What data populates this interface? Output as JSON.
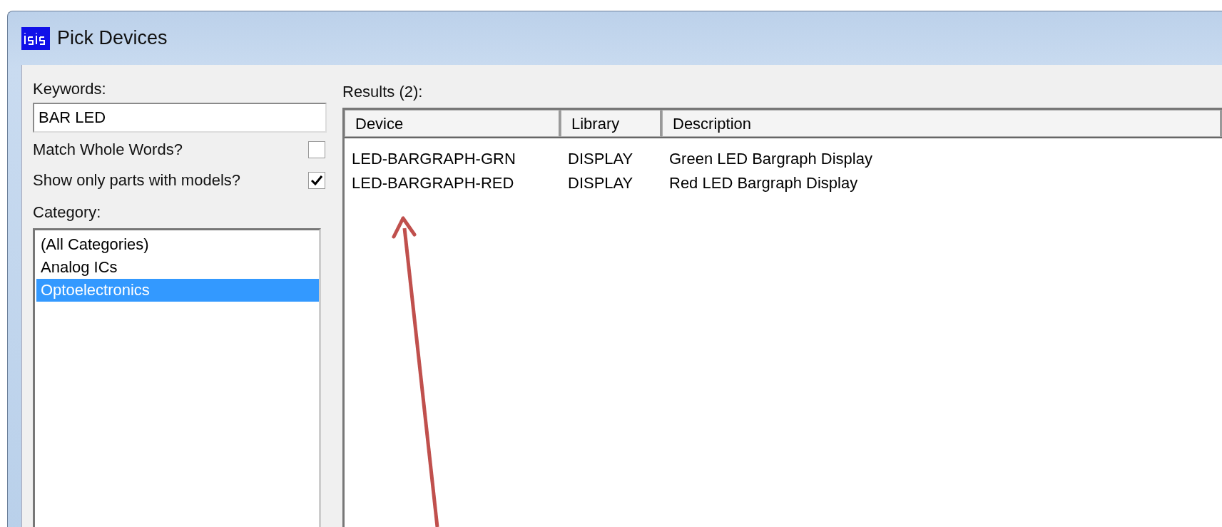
{
  "window": {
    "title": "Pick Devices"
  },
  "keywords": {
    "label": "Keywords:",
    "value": "BAR LED"
  },
  "options": [
    {
      "label": "Match Whole Words?",
      "checked": false
    },
    {
      "label": "Show only parts with models?",
      "checked": true
    }
  ],
  "category": {
    "label": "Category:",
    "items": [
      {
        "label": "(All Categories)",
        "selected": false
      },
      {
        "label": "Analog ICs",
        "selected": false
      },
      {
        "label": "Optoelectronics",
        "selected": true
      }
    ]
  },
  "results": {
    "label": "Results (2):",
    "columns": [
      "Device",
      "Library",
      "Description"
    ],
    "rows": [
      [
        "LED-BARGRAPH-GRN",
        "DISPLAY",
        "Green LED Bargraph Display"
      ],
      [
        "LED-BARGRAPH-RED",
        "DISPLAY",
        "Red LED Bargraph Display"
      ]
    ]
  }
}
